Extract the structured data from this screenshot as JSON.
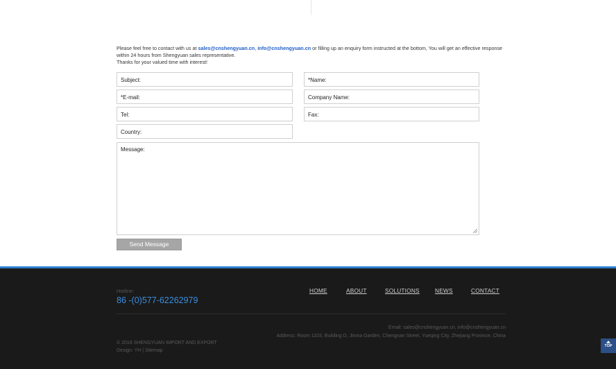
{
  "intro": {
    "lead": "Please feel free to contact with us at ",
    "email1": "sales@cnshengyuan.cn",
    "comma": ", ",
    "email2": "info@cnshengyuan.cn",
    "rest": " or filling up an enquiry form instructed at the bottom, You will get an effective response within 24 hours from Shengyuan sales representative.",
    "thanks": "Thanks for your valued time with interest!"
  },
  "form": {
    "subject_placeholder": "Subject:",
    "name_placeholder": "*Name:",
    "email_placeholder": "*E-mail:",
    "company_placeholder": "Company Name:",
    "tel_placeholder": "Tel:",
    "fax_placeholder": "Fax:",
    "country_placeholder": "Country:",
    "message_placeholder": "Message:",
    "send_label": "Send Message"
  },
  "footer": {
    "hotline_label": "Hotline:",
    "hotline_number": "86 -(0)577-62262979",
    "nav": {
      "home": "HOME",
      "about": "ABOUT",
      "solutions": "SOLUTIONS",
      "news": "NEWS",
      "contact": "CONTACT"
    },
    "contact_email": "Email: sales@cnshengyuan.cn, info@cnshengyuan.cn",
    "contact_address": "Address: Room 1103, Building D, Jinma Garden, Chengnan Street, Yueqing City, Zhejiang Province, China",
    "copyright": "© 2018 SHENGYUAN IMPORT AND EXPORT",
    "design_prefix": "Design: ",
    "design_by": "YH",
    "design_sep": " | ",
    "sitemap": "Sitemap"
  },
  "top_button": {
    "label": "TOP"
  },
  "colors": {
    "accent": "#2b7fcf",
    "link": "#1f5fc7",
    "footer_bg": "#1a1a1a",
    "button": "#a6a6a6"
  }
}
